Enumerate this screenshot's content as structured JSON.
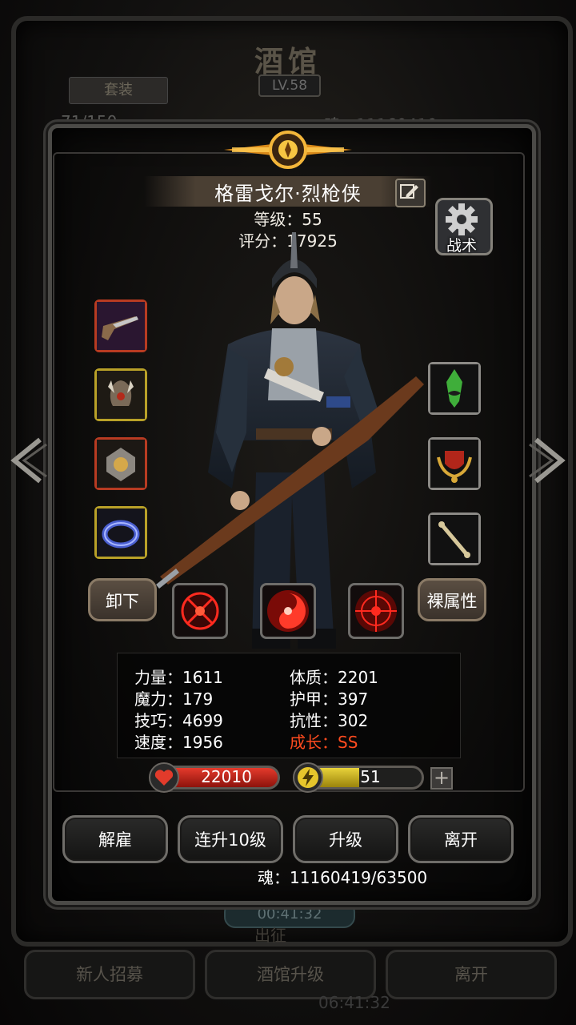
{
  "background": {
    "title": "酒馆",
    "level": "LV.58",
    "tab": "套装",
    "count": "71/150",
    "soul": "魂：11160419",
    "timer": "00:41:32",
    "subtitle": "出征",
    "buttons": [
      "新人招募",
      "酒馆升级",
      "离开"
    ],
    "bottom_time": "06:41:32"
  },
  "character": {
    "name": "格雷戈尔·烈枪侠",
    "level_line": "等级：55",
    "score_line": "评分：17925"
  },
  "tactics_label": "战术",
  "equipment": {
    "left": [
      {
        "icon": "pistol-icon",
        "frame": "red"
      },
      {
        "icon": "horned-helmet-icon",
        "frame": "yellow"
      },
      {
        "icon": "gem-amulet-icon",
        "frame": "red"
      },
      {
        "icon": "ring-icon",
        "frame": "yellow"
      }
    ],
    "right": [
      {
        "icon": "green-crystal-icon",
        "frame": "grey"
      },
      {
        "icon": "crest-icon",
        "frame": "grey"
      },
      {
        "icon": "bone-relic-icon",
        "frame": "grey"
      }
    ]
  },
  "unequip_label": "卸下",
  "base_attr_label": "裸属性",
  "skills": [
    "crosshair-skill-icon",
    "swirl-skill-icon",
    "target-skill-icon"
  ],
  "stats": {
    "strength": "力量：1611",
    "physique": "体质：2201",
    "magic": "魔力：179",
    "armor": "护甲：397",
    "skill": "技巧：4699",
    "resist": "抗性：302",
    "speed": "速度：1956",
    "growth": "成长：SS"
  },
  "hp": "22010",
  "energy": "51",
  "energy_fraction": 0.5,
  "actions": [
    "解雇",
    "连升10级",
    "升级",
    "离开"
  ],
  "soul_line": "魂：11160419/63500",
  "colors": {
    "growth": "#ff4b1f",
    "hp": "#e53a2c",
    "energy": "#e8d23a"
  }
}
